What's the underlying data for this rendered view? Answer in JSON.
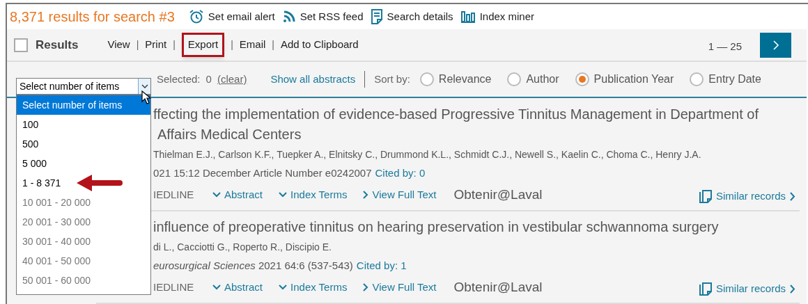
{
  "header": {
    "title": "8,371 results for search #3",
    "actions": [
      {
        "label": "Set email alert"
      },
      {
        "label": "Set RSS feed"
      },
      {
        "label": "Search details"
      },
      {
        "label": "Index miner"
      }
    ]
  },
  "toolbar": {
    "select_all_checked": false,
    "label": "Results",
    "links": [
      {
        "label": "View",
        "highlighted": false
      },
      {
        "label": "Print",
        "highlighted": false
      },
      {
        "label": "Export",
        "highlighted": true
      },
      {
        "label": "Email",
        "highlighted": false
      },
      {
        "label": "Add to Clipboard",
        "highlighted": false
      }
    ],
    "separator": "|",
    "pagination": "1 — 25"
  },
  "sort_row": {
    "dropdown_value": "Select number of items",
    "selected_label": "Selected:",
    "selected_count": "0",
    "clear": "(clear)",
    "show_all": "Show all abstracts",
    "sort_label": "Sort by:",
    "options": [
      {
        "label": "Relevance",
        "selected": false
      },
      {
        "label": "Author",
        "selected": false
      },
      {
        "label": "Publication Year",
        "selected": true
      },
      {
        "label": "Entry Date",
        "selected": false
      }
    ]
  },
  "dropdown": {
    "open": true,
    "options": [
      {
        "label": "Select number of items",
        "selected": true,
        "disabled": false,
        "pointed": false
      },
      {
        "label": "100",
        "selected": false,
        "disabled": false,
        "pointed": false
      },
      {
        "label": "500",
        "selected": false,
        "disabled": false,
        "pointed": false
      },
      {
        "label": "5 000",
        "selected": false,
        "disabled": false,
        "pointed": false
      },
      {
        "label": "1 - 8 371",
        "selected": false,
        "disabled": false,
        "pointed": true
      },
      {
        "label": "10 001 - 20 000",
        "selected": false,
        "disabled": true,
        "pointed": false
      },
      {
        "label": "20 001 - 30 000",
        "selected": false,
        "disabled": true,
        "pointed": false
      },
      {
        "label": "30 001 - 40 000",
        "selected": false,
        "disabled": true,
        "pointed": false
      },
      {
        "label": "40 001 - 50 000",
        "selected": false,
        "disabled": true,
        "pointed": false
      },
      {
        "label": "50 001 - 60 000",
        "selected": false,
        "disabled": true,
        "pointed": false
      }
    ]
  },
  "results": [
    {
      "title_lines": [
        "ffecting the implementation of evidence-based Progressive Tinnitus Management in Department of",
        "Affairs Medical Centers"
      ],
      "authors": "Thielman E.J., Carlson K.F., Tuepker A., Elnitsky C., Drummond K.L., Schmidt C.J., Newell S., Kaelin C., Choma C., Henry J.A.",
      "source": "021 15:12 December Article Number e0242007",
      "cited_by": "Cited by: 0",
      "database": "IEDLINE",
      "links": [
        "Abstract",
        "Index Terms",
        "View Full Text"
      ],
      "obtain": "Obtenir@Laval",
      "similar": "Similar records"
    },
    {
      "title_lines": [
        "influence of preoperative tinnitus on hearing preservation in vestibular schwannoma surgery"
      ],
      "authors": "di L., Cacciotti G., Roperto R., Discipio E.",
      "source": "*eurosurgical Sciences* 2021 64:6 (537-543)",
      "cited_by": "Cited by: 1",
      "database": "IEDLINE",
      "links": [
        "Abstract",
        "Index Terms",
        "View Full Text"
      ],
      "obtain": "Obtenir@Laval",
      "similar": "Similar records"
    }
  ]
}
